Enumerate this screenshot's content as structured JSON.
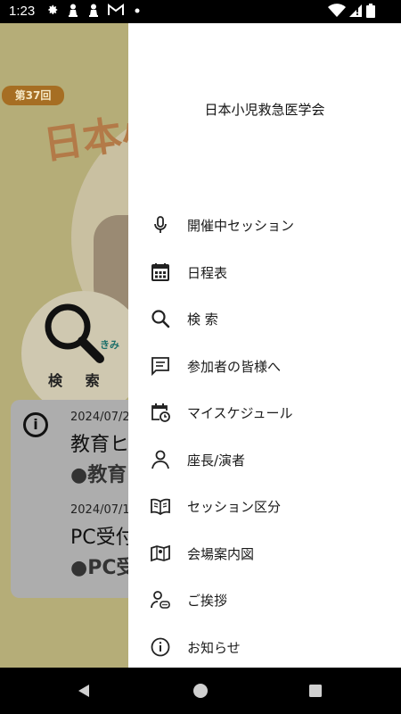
{
  "status_bar": {
    "time": "1:23"
  },
  "background": {
    "badge": "第37回",
    "logo_text": "日本小",
    "search_label": "検 索",
    "kimi_text": "きみ",
    "notices": [
      {
        "date": "2024/07/2",
        "title": "教育ヒ",
        "subtitle": "●教育"
      },
      {
        "date": "2024/07/1",
        "title": "PC受付",
        "subtitle": "●PC受"
      }
    ]
  },
  "drawer": {
    "header": "日本小児救急医学会",
    "items": [
      {
        "label": "開催中セッション",
        "icon": "microphone-icon"
      },
      {
        "label": "日程表",
        "icon": "calendar-icon"
      },
      {
        "label": "検 索",
        "icon": "search-icon"
      },
      {
        "label": "参加者の皆様へ",
        "icon": "message-icon"
      },
      {
        "label": "マイスケジュール",
        "icon": "schedule-clock-icon"
      },
      {
        "label": "座長/演者",
        "icon": "person-icon"
      },
      {
        "label": "セッション区分",
        "icon": "book-icon"
      },
      {
        "label": "会場案内図",
        "icon": "map-icon"
      },
      {
        "label": "ご挨拶",
        "icon": "greeting-icon"
      },
      {
        "label": "お知らせ",
        "icon": "info-icon"
      }
    ]
  },
  "colors": {
    "drawer_bg": "#ffffff",
    "scrim": "#b5ad78"
  }
}
